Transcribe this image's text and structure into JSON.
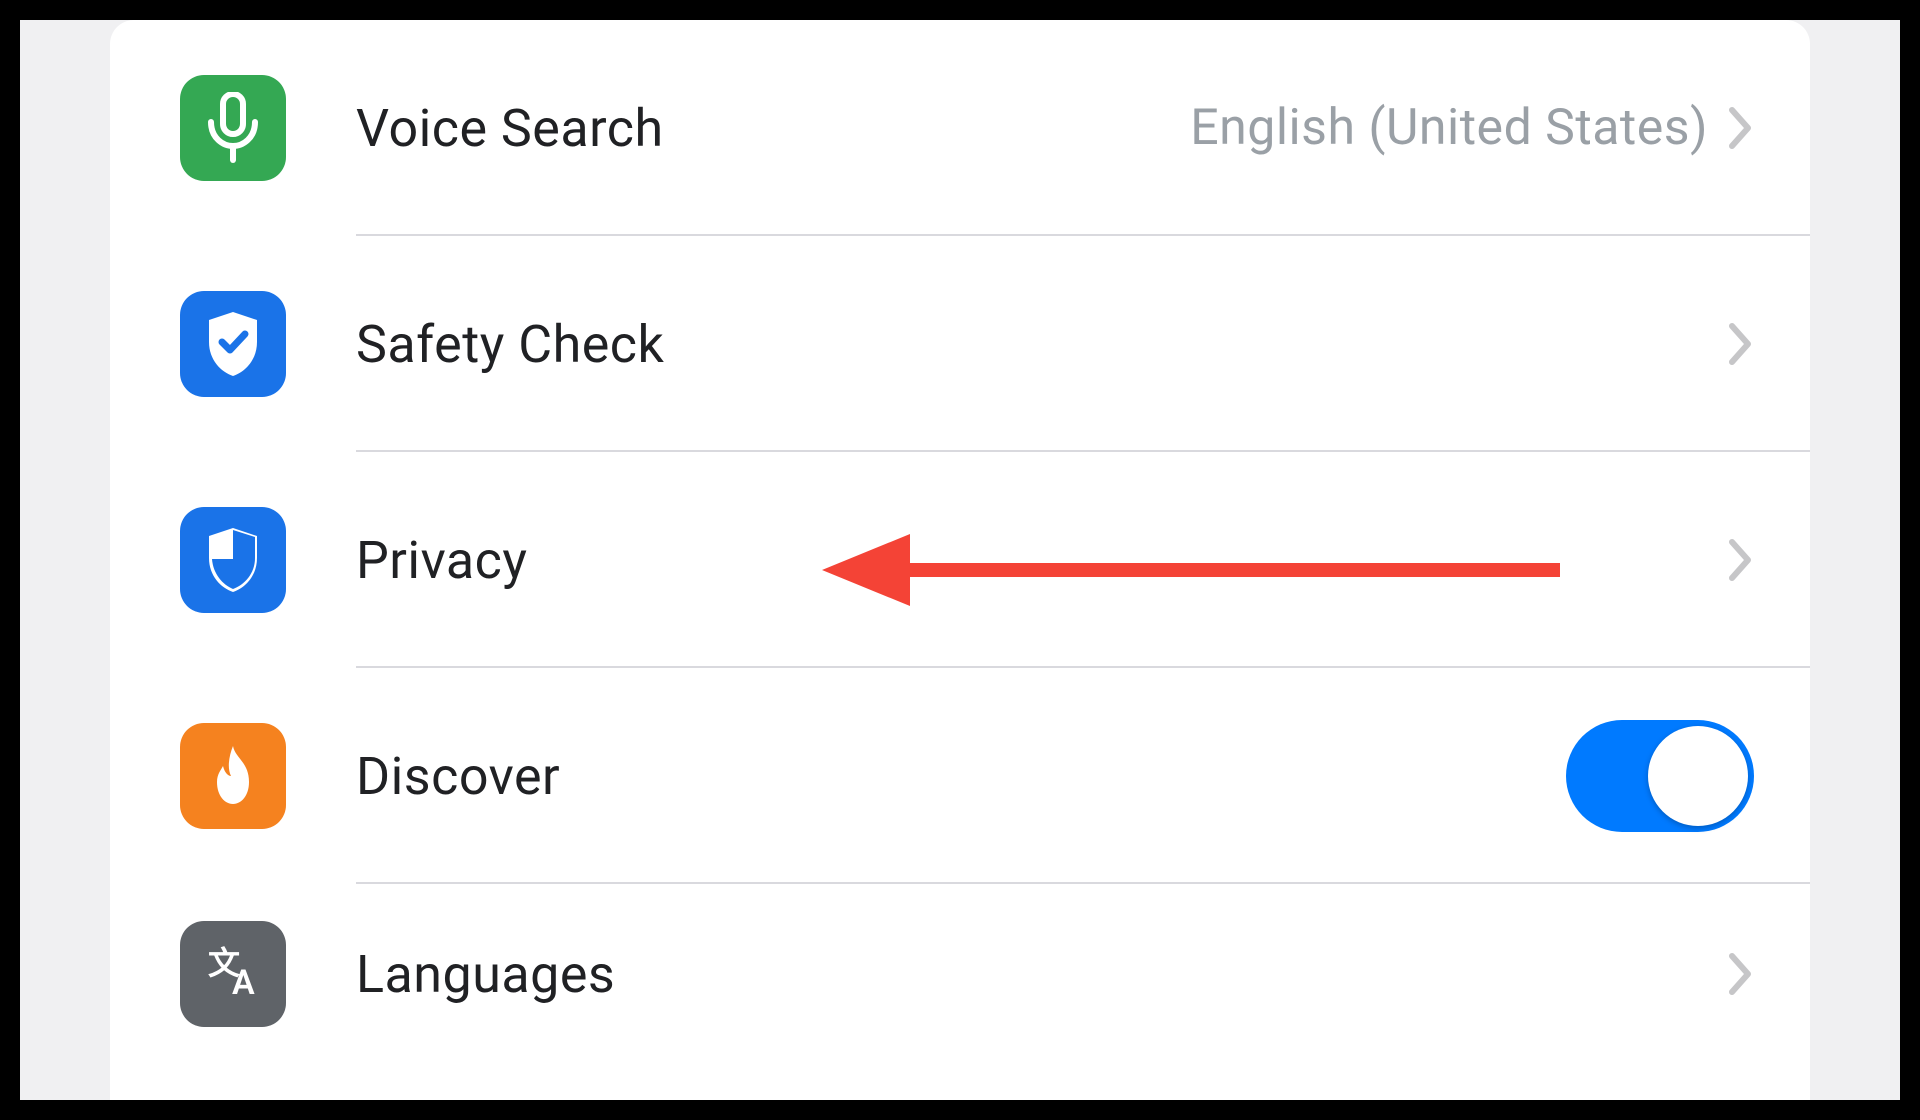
{
  "settings": {
    "items": [
      {
        "label": "Voice Search",
        "value": "English (United States)",
        "icon": "microphone-icon",
        "iconColor": "green",
        "accessory": "chevron"
      },
      {
        "label": "Safety Check",
        "value": "",
        "icon": "shield-check-icon",
        "iconColor": "blue",
        "accessory": "chevron"
      },
      {
        "label": "Privacy",
        "value": "",
        "icon": "shield-privacy-icon",
        "iconColor": "blue",
        "accessory": "chevron"
      },
      {
        "label": "Discover",
        "value": "",
        "icon": "flame-icon",
        "iconColor": "orange",
        "accessory": "toggle",
        "toggle": true
      },
      {
        "label": "Languages",
        "value": "",
        "icon": "translate-icon",
        "iconColor": "gray",
        "accessory": "chevron"
      }
    ]
  },
  "annotation": {
    "target": "Privacy"
  }
}
